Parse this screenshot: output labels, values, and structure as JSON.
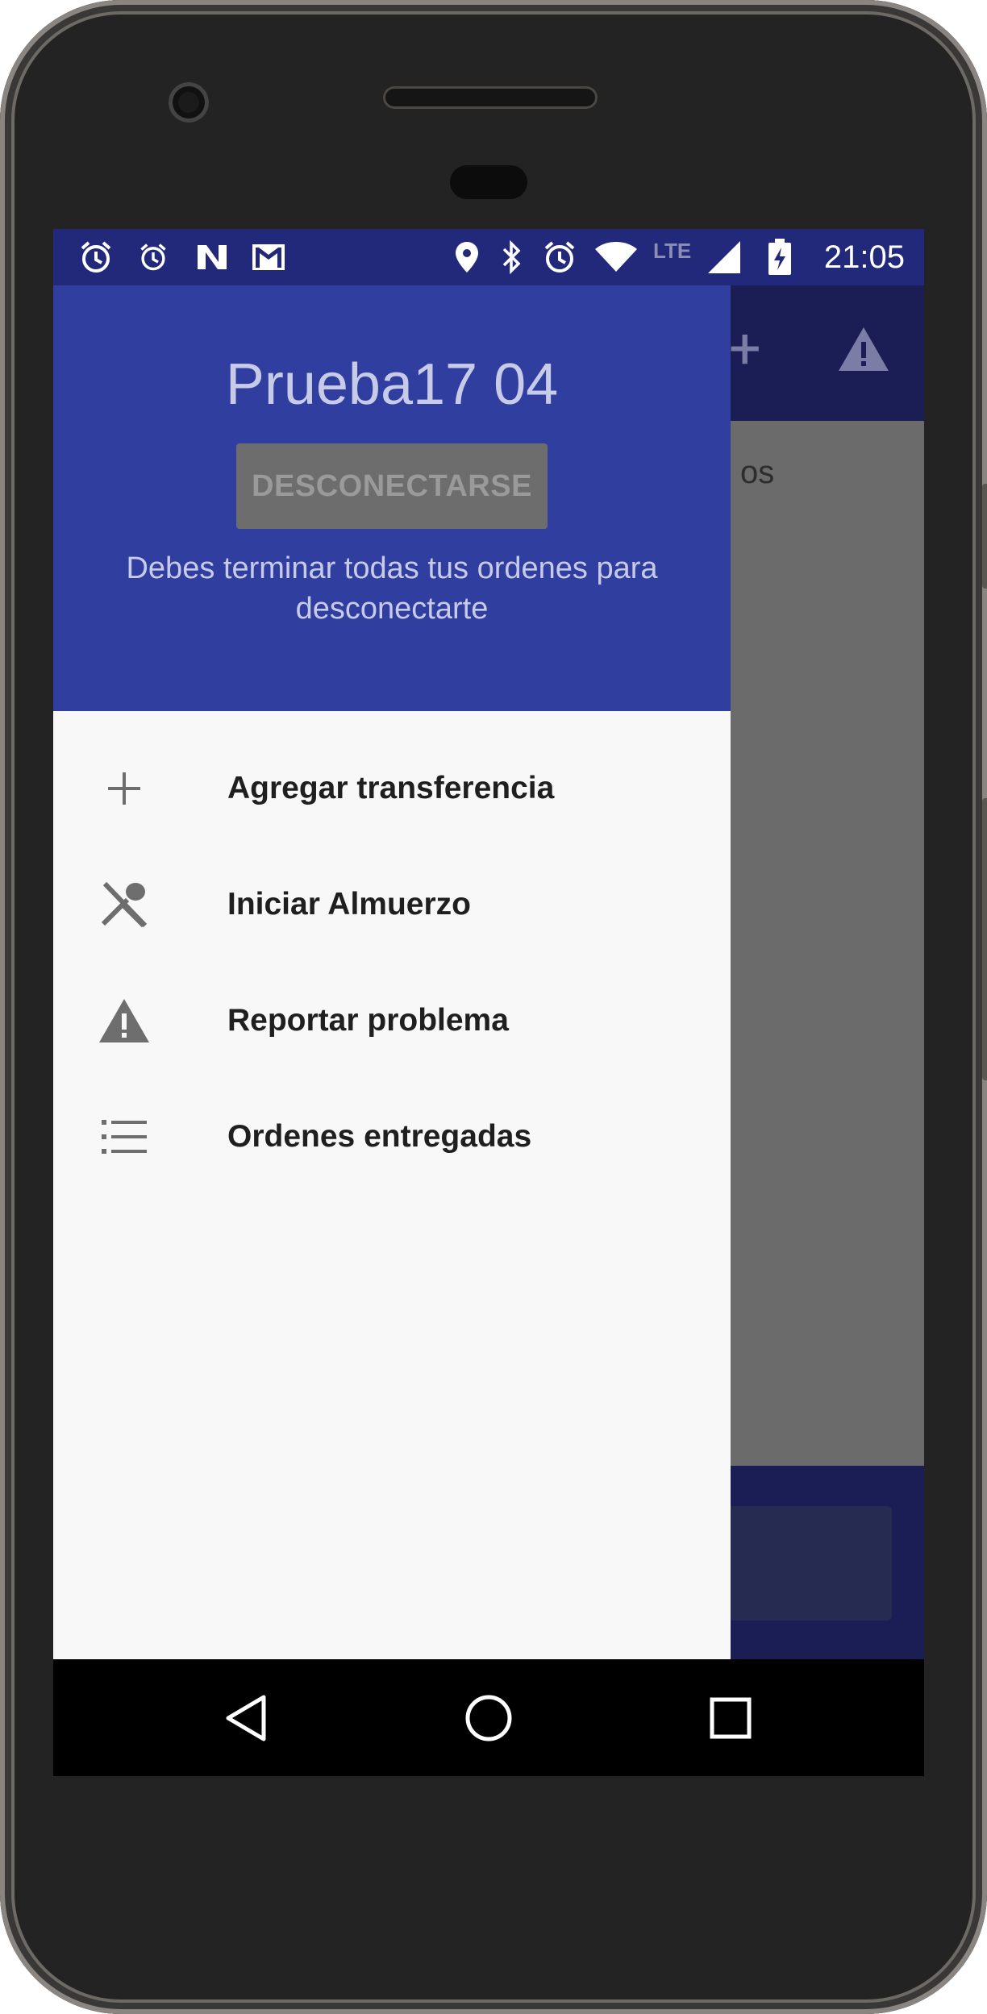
{
  "status_bar": {
    "time": "21:05",
    "network_label": "LTE",
    "left_icons": [
      "alarm-icon",
      "alarm-icon",
      "n-app-icon",
      "gmail-icon"
    ],
    "right_icons": [
      "location-icon",
      "bluetooth-icon",
      "alarm-icon",
      "wifi-icon",
      "signal-icon",
      "battery-charging-icon"
    ]
  },
  "background_app": {
    "partial_text": "os"
  },
  "drawer": {
    "user_name": "Prueba17 04",
    "disconnect_button": "DESCONECTARSE",
    "disconnect_note": "Debes terminar todas tus ordenes para desconectarte",
    "menu": [
      {
        "icon": "plus-icon",
        "label": "Agregar transferencia"
      },
      {
        "icon": "utensils-icon",
        "label": "Iniciar Almuerzo"
      },
      {
        "icon": "warning-icon",
        "label": "Reportar problema"
      },
      {
        "icon": "list-icon",
        "label": "Ordenes entregadas"
      }
    ]
  },
  "nav_bar": {
    "buttons": [
      "back-icon",
      "home-icon",
      "recents-icon"
    ]
  },
  "colors": {
    "primary": "#303f9f",
    "primary_dark": "#23297a",
    "drawer_bg": "#f8f8f8",
    "scrim": "#6b6b6b"
  }
}
